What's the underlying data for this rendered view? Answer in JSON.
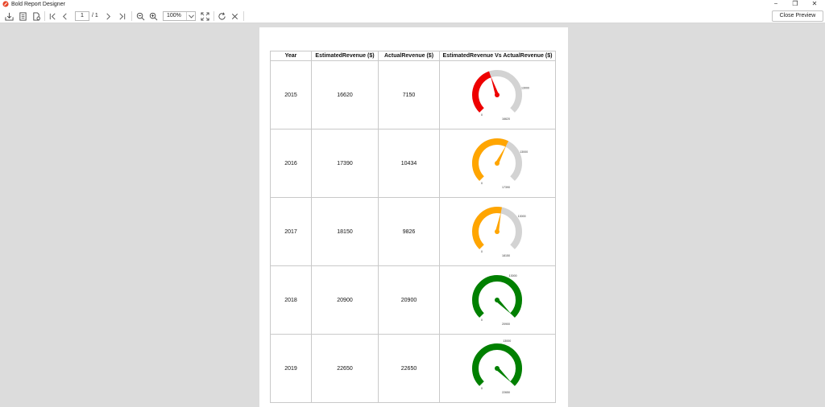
{
  "app": {
    "title": "Bold Report Designer",
    "window_controls": {
      "minimize": "−",
      "restore": "❐",
      "close": "✕"
    }
  },
  "toolbar": {
    "icons": [
      "export-icon",
      "print-layout-icon",
      "page-setup-icon",
      "first-page-icon",
      "previous-page-icon",
      "next-page-icon",
      "last-page-icon",
      "zoom-out-icon",
      "zoom-in-icon",
      "fit-page-icon",
      "refresh-icon",
      "cancel-icon"
    ],
    "page_number": "1",
    "page_total": "/ 1",
    "zoom": "100%",
    "close_preview": "Close Preview"
  },
  "report": {
    "headers": [
      "Year",
      "EstimatedRevenue ($)",
      "ActualRevenue ($)",
      "EstimatedRevenue Vs ActualRevenue ($)"
    ],
    "rows": [
      {
        "year": "2015",
        "estimated": "16620",
        "actual": "7150",
        "gauge": {
          "min_label": "0",
          "max_label": "16620",
          "target_label": "13000",
          "value": 7150,
          "max": 16620,
          "color": "#ee0000"
        }
      },
      {
        "year": "2016",
        "estimated": "17390",
        "actual": "10434",
        "gauge": {
          "min_label": "0",
          "max_label": "17390",
          "target_label": "13000",
          "value": 10434,
          "max": 17390,
          "color": "#ffa500"
        }
      },
      {
        "year": "2017",
        "estimated": "18150",
        "actual": "9826",
        "gauge": {
          "min_label": "0",
          "max_label": "18150",
          "target_label": "13000",
          "value": 9826,
          "max": 18150,
          "color": "#ffa500"
        }
      },
      {
        "year": "2018",
        "estimated": "20900",
        "actual": "20900",
        "gauge": {
          "min_label": "0",
          "max_label": "20900",
          "target_label": "13000",
          "value": 20900,
          "max": 20900,
          "color": "#008000"
        }
      },
      {
        "year": "2019",
        "estimated": "22650",
        "actual": "22650",
        "gauge": {
          "min_label": "0",
          "max_label": "22650",
          "target_label": "13000",
          "value": 22650,
          "max": 22650,
          "color": "#008000"
        }
      }
    ],
    "track_color": "#d3d3d3",
    "needle_color_default": "#008000"
  }
}
